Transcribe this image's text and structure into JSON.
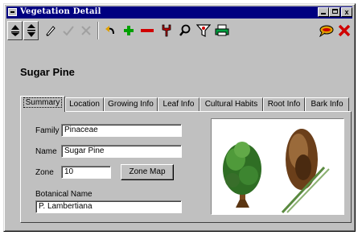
{
  "window": {
    "title": "Vegetation Detail",
    "caption_buttons": {
      "minimize": "_",
      "maximize": "□",
      "close": "x"
    }
  },
  "toolbar": {
    "icons": [
      "first-record-icon",
      "last-record-icon",
      "pencil-icon",
      "check-icon",
      "cancel-icon",
      "undo-icon",
      "add-icon",
      "remove-icon",
      "tools-icon",
      "search-icon",
      "filter-icon",
      "print-icon",
      "comment-icon",
      "close-icon"
    ]
  },
  "record": {
    "common_name": "Sugar Pine"
  },
  "tabs": [
    "Summary",
    "Location",
    "Growing Info",
    "Leaf Info",
    "Cultural Habits",
    "Root Info",
    "Bark Info"
  ],
  "active_tab": "Summary",
  "summary": {
    "family_label": "Family",
    "family_value": "Pinaceae",
    "name_label": "Name",
    "name_value": "Sugar Pine",
    "zone_label": "Zone",
    "zone_value": "10",
    "zone_map_label": "Zone Map",
    "botanical_label": "Botanical Name",
    "botanical_value": "P. Lambertiana"
  },
  "colors": {
    "titlebar": "#000080",
    "face": "#c0c0c0",
    "add": "#00a000",
    "remove": "#d00000"
  }
}
